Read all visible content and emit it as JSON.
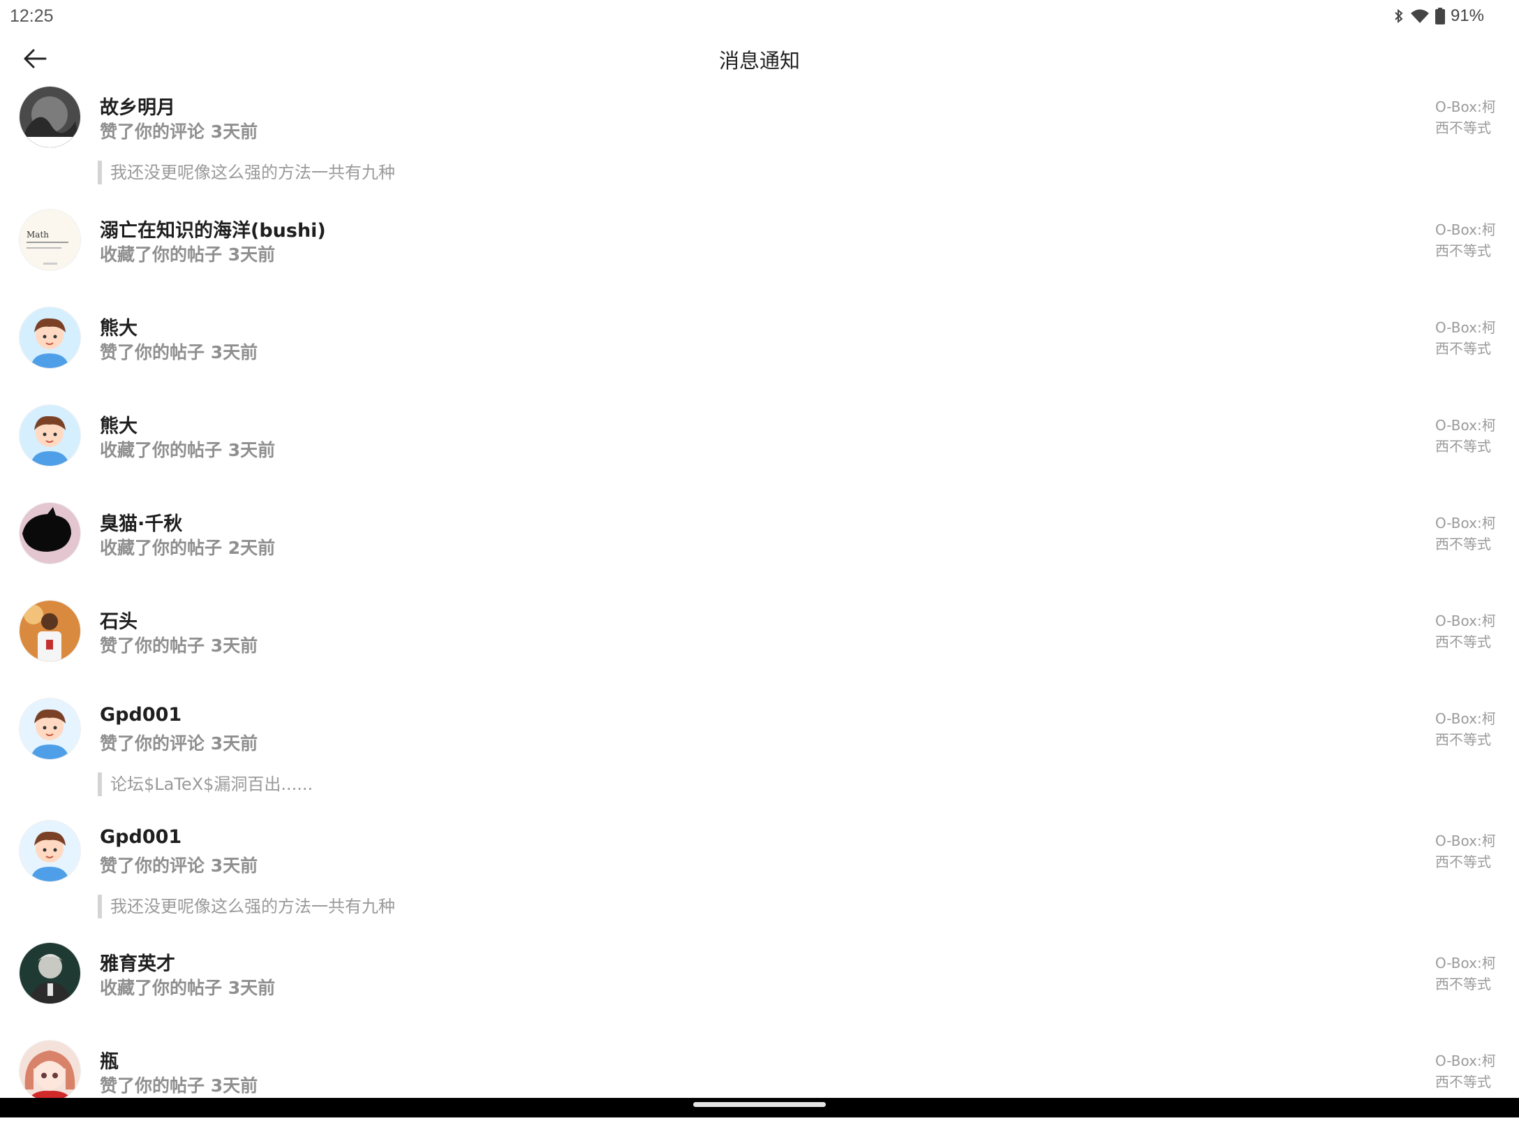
{
  "status_bar": {
    "time": "12:25",
    "battery": "91%",
    "icons": [
      "bluetooth-icon",
      "wifi-icon",
      "battery-icon"
    ]
  },
  "app_bar": {
    "title": "消息通知",
    "back_icon": "arrow-left-icon"
  },
  "notifications": [
    {
      "name": "故乡明月",
      "action": "赞了你的评论 3天前",
      "source": "O-Box:柯西不等式",
      "quote": "我还没更呢像这么强的方法一共有九种",
      "avatar": "dark-art"
    },
    {
      "name": "溺亡在知识的海洋(bushi)",
      "action": "收藏了你的帖子 3天前",
      "source": "O-Box:柯西不等式",
      "quote": "",
      "avatar": "math-card",
      "avatar_text": "Math"
    },
    {
      "name": "熊大",
      "action": "赞了你的帖子 3天前",
      "source": "O-Box:柯西不等式",
      "quote": "",
      "avatar": "cartoon-boy"
    },
    {
      "name": "熊大",
      "action": "收藏了你的帖子 3天前",
      "source": "O-Box:柯西不等式",
      "quote": "",
      "avatar": "cartoon-boy"
    },
    {
      "name": "臭猫·千秋",
      "action": "收藏了你的帖子 2天前",
      "source": "O-Box:柯西不等式",
      "quote": "",
      "avatar": "black-cat"
    },
    {
      "name": "石头",
      "action": "赞了你的帖子 3天前",
      "source": "O-Box:柯西不等式",
      "quote": "",
      "avatar": "player-photo"
    },
    {
      "name": "Gpd001",
      "action": "赞了你的评论 3天前",
      "source": "O-Box:柯西不等式",
      "quote": "论坛$LaTeX$漏洞百出......",
      "avatar": "cartoon-boy"
    },
    {
      "name": "Gpd001",
      "action": "赞了你的评论 3天前",
      "source": "O-Box:柯西不等式",
      "quote": "我还没更呢像这么强的方法一共有九种",
      "avatar": "cartoon-boy"
    },
    {
      "name": "雅育英才",
      "action": "收藏了你的帖子 3天前",
      "source": "O-Box:柯西不等式",
      "quote": "",
      "avatar": "portrait-photo"
    },
    {
      "name": "瓶",
      "action": "赞了你的帖子 3天前",
      "source": "O-Box:柯西不等式",
      "quote": "",
      "avatar": "anime-girl"
    }
  ],
  "colors": {
    "accent_quote_bar": "#d4d4d4",
    "muted_text": "#8f8f8f"
  }
}
